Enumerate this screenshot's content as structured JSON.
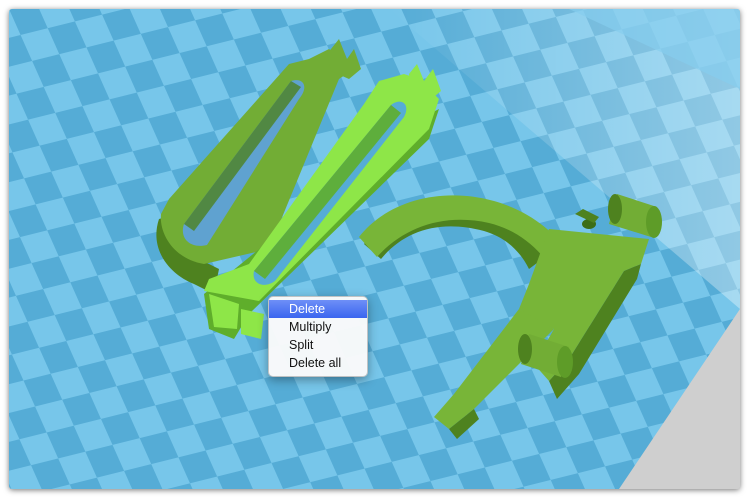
{
  "colors": {
    "bed_light": "#77c6ea",
    "bed_dark": "#55acd6",
    "bed_shadow": "#4a9cc8",
    "part_top": "#78b538",
    "part_side": "#4e821f",
    "part_highlight": "#8ee648",
    "part_highlight_side": "#5fae2b",
    "background_gray": "#cfcfcf",
    "menu_highlight": "#3a65ef"
  },
  "context_menu": {
    "items": [
      {
        "label": "Delete",
        "highlighted": true
      },
      {
        "label": "Multiply",
        "highlighted": false
      },
      {
        "label": "Split",
        "highlighted": false
      },
      {
        "label": "Delete all",
        "highlighted": false
      }
    ]
  }
}
